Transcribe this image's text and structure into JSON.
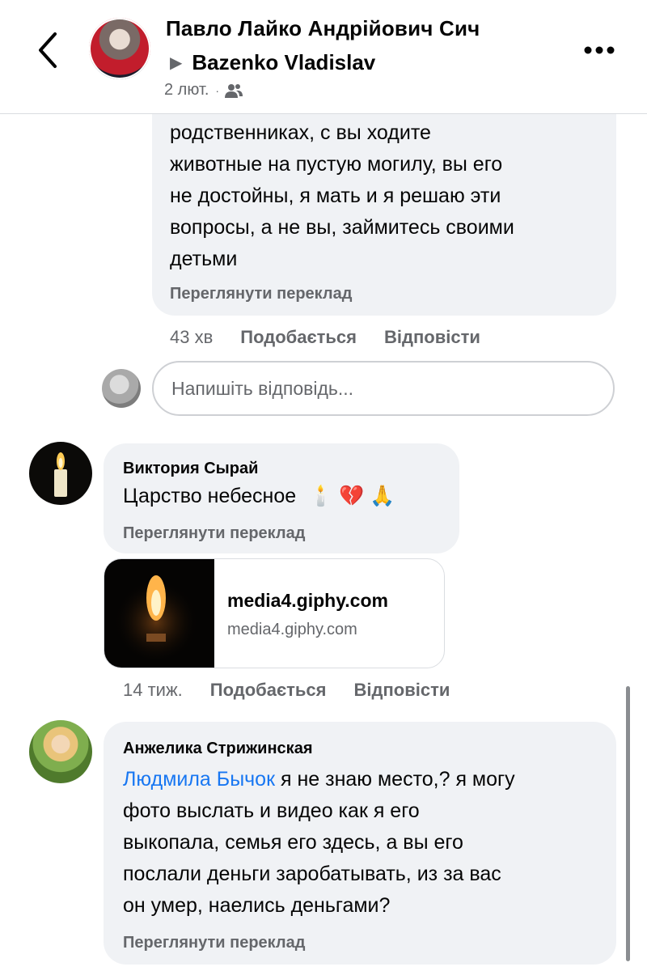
{
  "header": {
    "author": "Павло Лайко Андрійович Сич",
    "target": "Bazenko Vladislav",
    "date": "2 лют.",
    "separator": "·",
    "audience_icon": "friends-icon",
    "back_icon": "chevron-left-icon",
    "more_icon": "more-icon"
  },
  "comments": [
    {
      "text_lines": [
        "родственниках, с вы ходите",
        "животные на пустую могилу, вы его",
        "не достойны, я мать и я решаю эти",
        "вопросы, а не вы, займитесь своими",
        "детьми"
      ],
      "translate": "Переглянути переклад",
      "time": "43 хв",
      "like": "Подобається",
      "reply": "Відповісти"
    },
    {
      "author": "Виктория Сырай",
      "text": "Царство небесное",
      "emojis": [
        "🕯️",
        "💔",
        "🙏"
      ],
      "translate": "Переглянути переклад",
      "link_title": "media4.giphy.com",
      "link_domain": "media4.giphy.com",
      "time": "14 тиж.",
      "like": "Подобається",
      "reply": "Відповісти"
    },
    {
      "author": "Анжелика Стрижинская",
      "mention": "Людмила Бычок",
      "text_first": " я не знаю место,? я могу",
      "text_lines": [
        "фото выслать и видео как я его",
        "выкопала, семья его здесь, а вы его",
        "послали деньги заробатывать, из за вас",
        "он умер, наелись деньгами?"
      ],
      "translate": "Переглянути переклад"
    }
  ],
  "reply_input": {
    "placeholder": "Напишіть відповідь..."
  },
  "colors": {
    "bubble": "#f0f2f5",
    "meta": "#65676b",
    "link": "#1877f2",
    "text": "#050505"
  }
}
